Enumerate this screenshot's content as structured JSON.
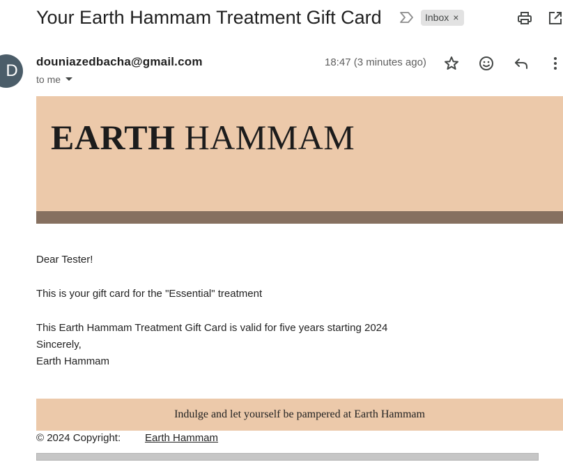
{
  "email": {
    "subject": "Your Earth Hammam Treatment Gift Card",
    "label": "Inbox",
    "label_close": "×",
    "sender_initial": "D",
    "sender": "douniazedbacha@gmail.com",
    "recipient": "to me",
    "time": "18:47 (3 minutes ago)"
  },
  "icons": {
    "importance": "importance-marker-icon",
    "print": "print-icon",
    "open_new": "open-in-new-window-icon",
    "star": "star-icon",
    "emoji": "emoji-reaction-icon",
    "reply": "reply-icon",
    "more": "more-vert-icon",
    "dropdown": "chevron-down-icon"
  },
  "body": {
    "brand_bold": "EARTH",
    "brand_light": "HAMMAM",
    "greeting": "Dear Tester!",
    "line1": "This is your gift card for the \"Essential\" treatment",
    "line2": "This Earth Hammam Treatment Gift Card is valid for five years starting 2024",
    "line3": "Sincerely,",
    "line4": "Earth Hammam",
    "tagline": "Indulge and let yourself be pampered at Earth Hammam",
    "copyright": "© 2024 Copyright:",
    "copyright_link": "Earth Hammam"
  },
  "colors": {
    "banner": "#ecc9aa",
    "stripe": "#867060",
    "avatar": "#4b5d69"
  }
}
